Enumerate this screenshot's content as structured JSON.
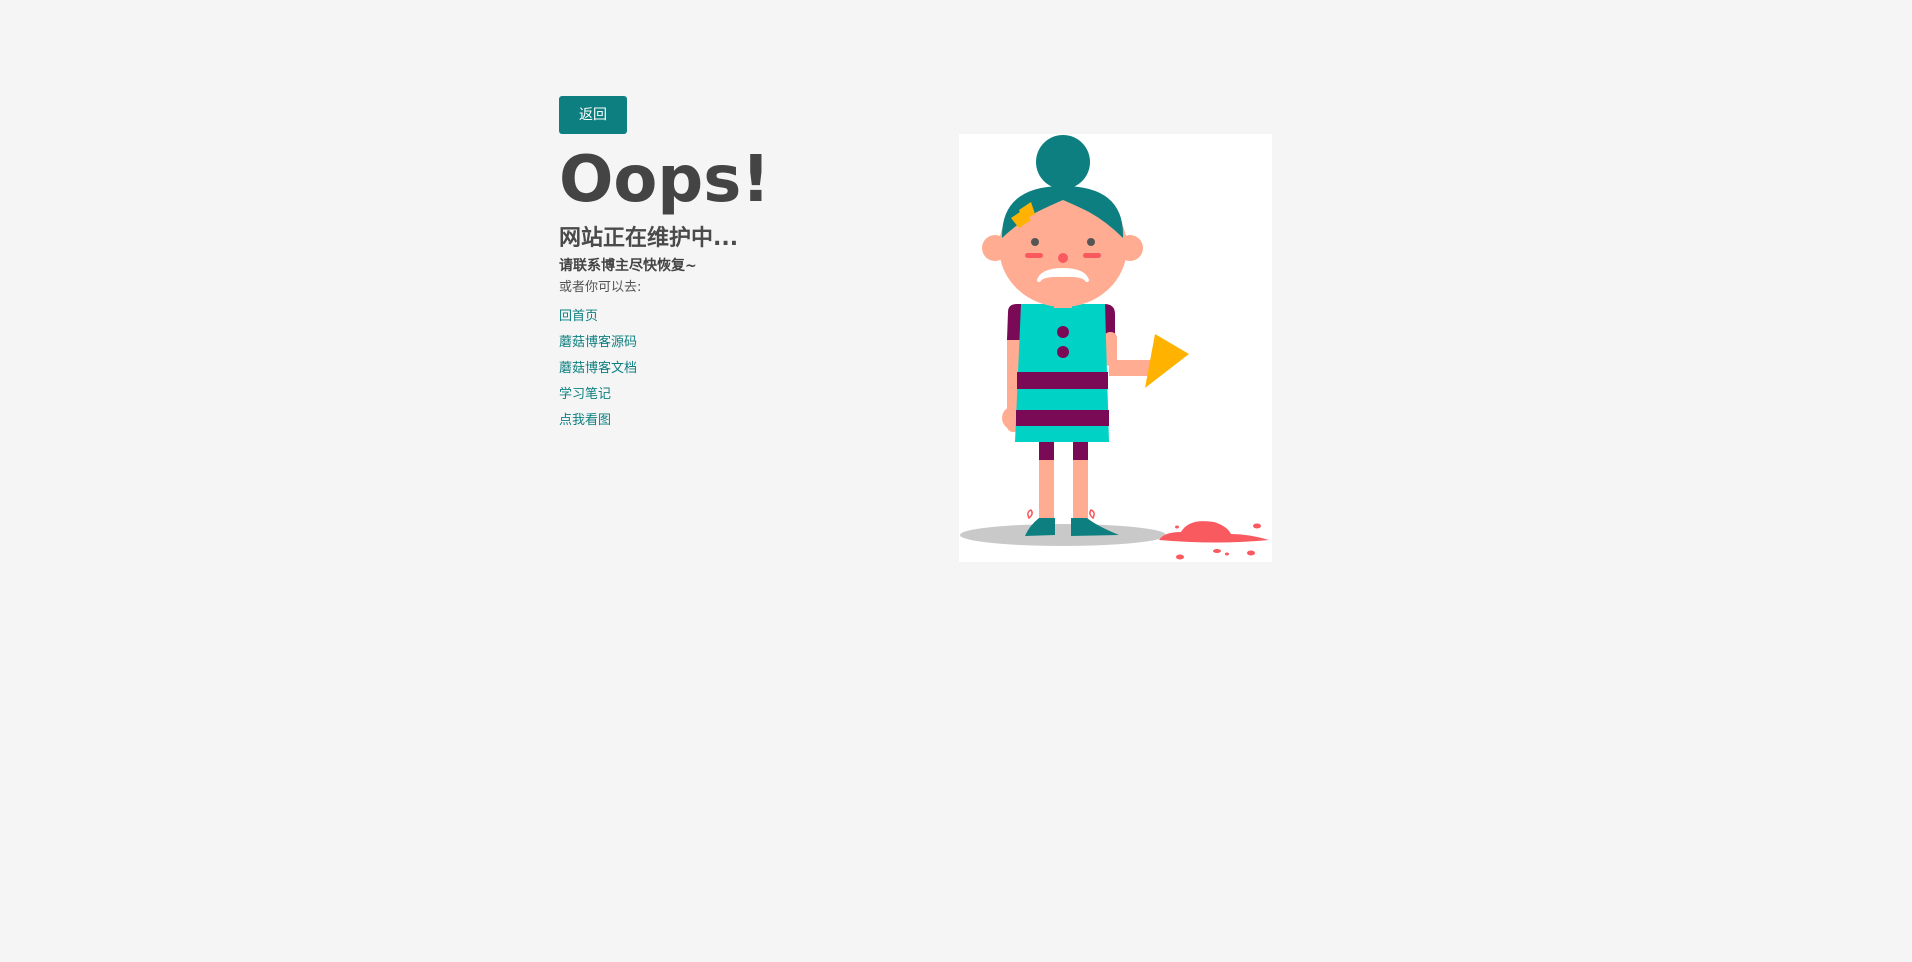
{
  "nav": {
    "back_label": "返回"
  },
  "heading": {
    "title": "Oops!",
    "subtitle": "网站正在维护中...",
    "contact": "请联系博主尽快恢复~",
    "or_label": "或者你可以去:"
  },
  "links": [
    {
      "label": "回首页"
    },
    {
      "label": "蘑菇博客源码"
    },
    {
      "label": "蘑菇博客文档"
    },
    {
      "label": "学习笔记"
    },
    {
      "label": "点我看图"
    }
  ],
  "colors": {
    "accent": "#0e7f80",
    "background": "#f5f5f5",
    "title_text": "#444444"
  },
  "illustration": {
    "subject": "girl-with-dropped-ice-cream"
  }
}
